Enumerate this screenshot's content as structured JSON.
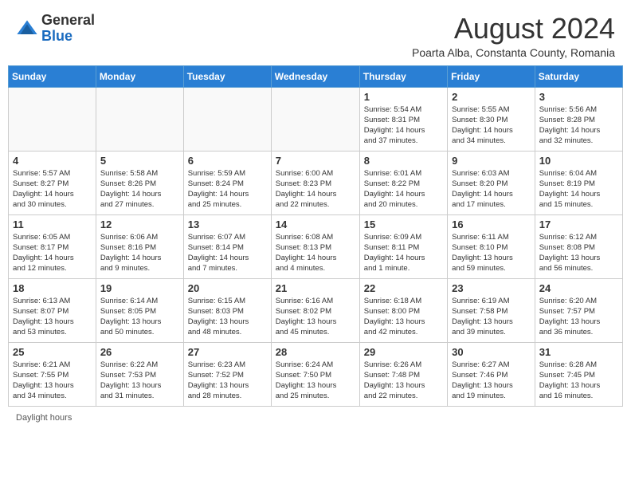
{
  "header": {
    "logo_general": "General",
    "logo_blue": "Blue",
    "month_year": "August 2024",
    "location": "Poarta Alba, Constanta County, Romania"
  },
  "days_of_week": [
    "Sunday",
    "Monday",
    "Tuesday",
    "Wednesday",
    "Thursday",
    "Friday",
    "Saturday"
  ],
  "weeks": [
    [
      {
        "day": "",
        "info": ""
      },
      {
        "day": "",
        "info": ""
      },
      {
        "day": "",
        "info": ""
      },
      {
        "day": "",
        "info": ""
      },
      {
        "day": "1",
        "info": "Sunrise: 5:54 AM\nSunset: 8:31 PM\nDaylight: 14 hours\nand 37 minutes."
      },
      {
        "day": "2",
        "info": "Sunrise: 5:55 AM\nSunset: 8:30 PM\nDaylight: 14 hours\nand 34 minutes."
      },
      {
        "day": "3",
        "info": "Sunrise: 5:56 AM\nSunset: 8:28 PM\nDaylight: 14 hours\nand 32 minutes."
      }
    ],
    [
      {
        "day": "4",
        "info": "Sunrise: 5:57 AM\nSunset: 8:27 PM\nDaylight: 14 hours\nand 30 minutes."
      },
      {
        "day": "5",
        "info": "Sunrise: 5:58 AM\nSunset: 8:26 PM\nDaylight: 14 hours\nand 27 minutes."
      },
      {
        "day": "6",
        "info": "Sunrise: 5:59 AM\nSunset: 8:24 PM\nDaylight: 14 hours\nand 25 minutes."
      },
      {
        "day": "7",
        "info": "Sunrise: 6:00 AM\nSunset: 8:23 PM\nDaylight: 14 hours\nand 22 minutes."
      },
      {
        "day": "8",
        "info": "Sunrise: 6:01 AM\nSunset: 8:22 PM\nDaylight: 14 hours\nand 20 minutes."
      },
      {
        "day": "9",
        "info": "Sunrise: 6:03 AM\nSunset: 8:20 PM\nDaylight: 14 hours\nand 17 minutes."
      },
      {
        "day": "10",
        "info": "Sunrise: 6:04 AM\nSunset: 8:19 PM\nDaylight: 14 hours\nand 15 minutes."
      }
    ],
    [
      {
        "day": "11",
        "info": "Sunrise: 6:05 AM\nSunset: 8:17 PM\nDaylight: 14 hours\nand 12 minutes."
      },
      {
        "day": "12",
        "info": "Sunrise: 6:06 AM\nSunset: 8:16 PM\nDaylight: 14 hours\nand 9 minutes."
      },
      {
        "day": "13",
        "info": "Sunrise: 6:07 AM\nSunset: 8:14 PM\nDaylight: 14 hours\nand 7 minutes."
      },
      {
        "day": "14",
        "info": "Sunrise: 6:08 AM\nSunset: 8:13 PM\nDaylight: 14 hours\nand 4 minutes."
      },
      {
        "day": "15",
        "info": "Sunrise: 6:09 AM\nSunset: 8:11 PM\nDaylight: 14 hours\nand 1 minute."
      },
      {
        "day": "16",
        "info": "Sunrise: 6:11 AM\nSunset: 8:10 PM\nDaylight: 13 hours\nand 59 minutes."
      },
      {
        "day": "17",
        "info": "Sunrise: 6:12 AM\nSunset: 8:08 PM\nDaylight: 13 hours\nand 56 minutes."
      }
    ],
    [
      {
        "day": "18",
        "info": "Sunrise: 6:13 AM\nSunset: 8:07 PM\nDaylight: 13 hours\nand 53 minutes."
      },
      {
        "day": "19",
        "info": "Sunrise: 6:14 AM\nSunset: 8:05 PM\nDaylight: 13 hours\nand 50 minutes."
      },
      {
        "day": "20",
        "info": "Sunrise: 6:15 AM\nSunset: 8:03 PM\nDaylight: 13 hours\nand 48 minutes."
      },
      {
        "day": "21",
        "info": "Sunrise: 6:16 AM\nSunset: 8:02 PM\nDaylight: 13 hours\nand 45 minutes."
      },
      {
        "day": "22",
        "info": "Sunrise: 6:18 AM\nSunset: 8:00 PM\nDaylight: 13 hours\nand 42 minutes."
      },
      {
        "day": "23",
        "info": "Sunrise: 6:19 AM\nSunset: 7:58 PM\nDaylight: 13 hours\nand 39 minutes."
      },
      {
        "day": "24",
        "info": "Sunrise: 6:20 AM\nSunset: 7:57 PM\nDaylight: 13 hours\nand 36 minutes."
      }
    ],
    [
      {
        "day": "25",
        "info": "Sunrise: 6:21 AM\nSunset: 7:55 PM\nDaylight: 13 hours\nand 34 minutes."
      },
      {
        "day": "26",
        "info": "Sunrise: 6:22 AM\nSunset: 7:53 PM\nDaylight: 13 hours\nand 31 minutes."
      },
      {
        "day": "27",
        "info": "Sunrise: 6:23 AM\nSunset: 7:52 PM\nDaylight: 13 hours\nand 28 minutes."
      },
      {
        "day": "28",
        "info": "Sunrise: 6:24 AM\nSunset: 7:50 PM\nDaylight: 13 hours\nand 25 minutes."
      },
      {
        "day": "29",
        "info": "Sunrise: 6:26 AM\nSunset: 7:48 PM\nDaylight: 13 hours\nand 22 minutes."
      },
      {
        "day": "30",
        "info": "Sunrise: 6:27 AM\nSunset: 7:46 PM\nDaylight: 13 hours\nand 19 minutes."
      },
      {
        "day": "31",
        "info": "Sunrise: 6:28 AM\nSunset: 7:45 PM\nDaylight: 13 hours\nand 16 minutes."
      }
    ]
  ],
  "footer": {
    "daylight_hours_label": "Daylight hours"
  }
}
